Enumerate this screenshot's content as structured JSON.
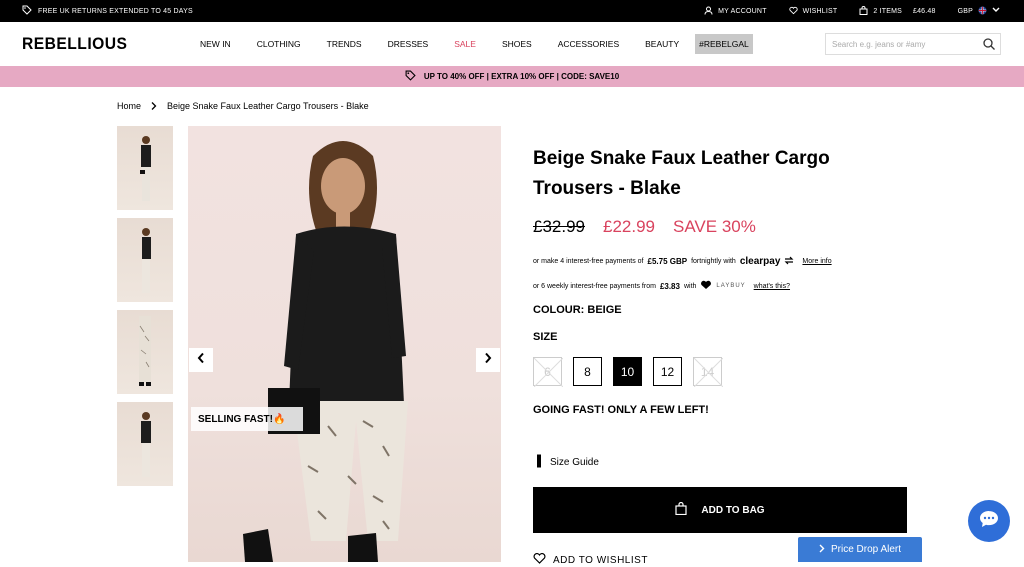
{
  "topbar": {
    "returns": "FREE UK RETURNS EXTENDED TO 45 DAYS",
    "account": "MY ACCOUNT",
    "wishlist": "WISHLIST",
    "bag_count": "2 ITEMS",
    "bag_total": "£46.48",
    "currency": "GBP"
  },
  "brand": {
    "logo": "REBELLIOUS"
  },
  "nav": {
    "items": [
      "NEW IN",
      "CLOTHING",
      "TRENDS",
      "DRESSES",
      "SALE",
      "SHOES",
      "ACCESSORIES",
      "BEAUTY",
      "#REBELGAL"
    ]
  },
  "search": {
    "placeholder": "Search e.g. jeans or #amy"
  },
  "promo": {
    "text": "UP TO 40% OFF | EXTRA 10% OFF | CODE: SAVE10"
  },
  "breadcrumb": {
    "home": "Home",
    "current": "Beige Snake Faux Leather Cargo Trousers - Blake"
  },
  "gallery": {
    "badge": "SELLING FAST!🔥"
  },
  "product": {
    "title": "Beige Snake Faux Leather Cargo Trousers - Blake",
    "was_price": "£32.99",
    "now_price": "£22.99",
    "save": "SAVE 30%",
    "clearpay_text_1": "or make 4 interest-free payments of",
    "clearpay_amount": "£5.75 GBP",
    "clearpay_text_2": "fortnightly with",
    "clearpay_brand": "clearpay",
    "clearpay_link": "More info",
    "laybuy_text_1": "or 6 weekly interest-free payments from",
    "laybuy_amount": "£3.83",
    "laybuy_text_2": "with",
    "laybuy_brand": "LAYBUY",
    "laybuy_link": "what's this?",
    "colour": "COLOUR: BEIGE",
    "size_heading": "SIZE",
    "sizes": [
      {
        "label": "6",
        "available": false,
        "selected": false
      },
      {
        "label": "8",
        "available": true,
        "selected": false
      },
      {
        "label": "10",
        "available": true,
        "selected": true
      },
      {
        "label": "12",
        "available": true,
        "selected": false
      },
      {
        "label": "14",
        "available": false,
        "selected": false
      }
    ],
    "stock_message": "GOING FAST! ONLY A FEW LEFT!",
    "size_guide": "Size Guide",
    "add_to_bag": "ADD TO BAG",
    "add_to_wishlist": "ADD TO WISHLIST"
  },
  "widgets": {
    "price_alert": "Price Drop Alert"
  },
  "colors": {
    "accent": "#d9435e",
    "promo_bg": "#e6a9c3",
    "chat_blue": "#2f6ed8"
  }
}
